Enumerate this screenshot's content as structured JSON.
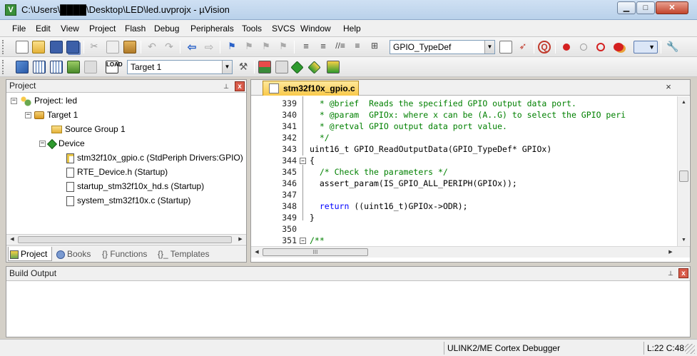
{
  "window": {
    "title": "C:\\Users\\████\\Desktop\\LED\\led.uvprojx - µVision",
    "minimize": "▁",
    "maximize": "□",
    "close": "✕"
  },
  "menu": [
    "File",
    "Edit",
    "View",
    "Project",
    "Flash",
    "Debug",
    "Peripherals",
    "Tools",
    "SVCS",
    "Window",
    "Help"
  ],
  "toolbar1": {
    "find_combo_value": "GPIO_TypeDef",
    "icons": [
      "new-file-icon",
      "open-folder-icon",
      "save-icon",
      "save-all-icon",
      "cut-icon",
      "copy-icon",
      "paste-icon",
      "undo-icon",
      "redo-icon",
      "nav-back-icon",
      "nav-forward-icon",
      "bookmark-icon",
      "bookmark-prev-icon",
      "bookmark-next-icon",
      "bookmark-clear-icon",
      "indent-icon",
      "unindent-icon",
      "comment-icon",
      "uncomment-icon",
      "find-in-files-icon",
      "find-icon",
      "debug-session-icon",
      "breakpoint-insert-icon",
      "breakpoint-enable-icon",
      "breakpoint-disable-icon",
      "breakpoint-kill-icon",
      "window-layout-icon",
      "configure-icon"
    ]
  },
  "toolbar2": {
    "target_combo_value": "Target 1",
    "icons": [
      "translate-icon",
      "build-icon",
      "rebuild-icon",
      "batch-build-icon",
      "stop-build-icon",
      "download-icon",
      "target-options-icon",
      "manage-components-icon",
      "file-extensions-icon",
      "select-packs-icon",
      "pack-installer-icon",
      "run-time-env-icon"
    ]
  },
  "project_panel": {
    "title": "Project",
    "pin": "📌",
    "close": "x",
    "tree": [
      {
        "label": "Project: led",
        "level": 0,
        "expander": "−",
        "icon": "project-icon"
      },
      {
        "label": "Target 1",
        "level": 1,
        "expander": "−",
        "icon": "target-icon"
      },
      {
        "label": "Source Group 1",
        "level": 2,
        "expander": "",
        "icon": "folder-icon"
      },
      {
        "label": "Device",
        "level": 2,
        "expander": "−",
        "icon": "device-icon"
      },
      {
        "label": "stm32f10x_gpio.c (StdPeriph Drivers:GPIO)",
        "level": 3,
        "expander": "",
        "icon": "key-file-icon"
      },
      {
        "label": "RTE_Device.h (Startup)",
        "level": 3,
        "expander": "",
        "icon": "file-icon"
      },
      {
        "label": "startup_stm32f10x_hd.s (Startup)",
        "level": 3,
        "expander": "",
        "icon": "file-icon"
      },
      {
        "label": "system_stm32f10x.c (Startup)",
        "level": 3,
        "expander": "",
        "icon": "file-icon"
      }
    ],
    "tabs": [
      {
        "label": "Project",
        "icon": "project-tab-icon",
        "active": true
      },
      {
        "label": "Books",
        "icon": "books-icon",
        "active": false
      },
      {
        "label": "{} Functions",
        "icon": "",
        "active": false
      },
      {
        "label": "{}_ Templates",
        "icon": "",
        "active": false
      }
    ]
  },
  "editor": {
    "file_tab": "stm32f10x_gpio.c",
    "close": "×",
    "lines": [
      {
        "num": "339",
        "fold": "",
        "text": "  * @brief  Reads the specified GPIO output data port.",
        "style": "comment"
      },
      {
        "num": "340",
        "fold": "",
        "text": "  * @param  GPIOx: where x can be (A..G) to select the GPIO peri",
        "style": "comment"
      },
      {
        "num": "341",
        "fold": "",
        "text": "  * @retval GPIO output data port value.",
        "style": "comment"
      },
      {
        "num": "342",
        "fold": "",
        "text": "  */",
        "style": "comment"
      },
      {
        "num": "343",
        "fold": "",
        "text": "uint16_t GPIO_ReadOutputData(GPIO_TypeDef* GPIOx)",
        "style": "code"
      },
      {
        "num": "344",
        "fold": "−",
        "text": "{",
        "style": "code"
      },
      {
        "num": "345",
        "fold": "",
        "text": "  /* Check the parameters */",
        "style": "comment"
      },
      {
        "num": "346",
        "fold": "",
        "text": "  assert_param(IS_GPIO_ALL_PERIPH(GPIOx));",
        "style": "code"
      },
      {
        "num": "347",
        "fold": "",
        "text": "",
        "style": "code"
      },
      {
        "num": "348",
        "fold": "",
        "text": "  return ((uint16_t)GPIOx->ODR);",
        "style": "return"
      },
      {
        "num": "349",
        "fold": "",
        "text": "}",
        "style": "code"
      },
      {
        "num": "350",
        "fold": "",
        "text": "",
        "style": "code"
      },
      {
        "num": "351",
        "fold": "−",
        "text": "/**",
        "style": "comment"
      }
    ],
    "hscroll_thumb": "III"
  },
  "build_output": {
    "title": "Build Output",
    "pin": "📌",
    "close": "x"
  },
  "status": {
    "debugger": "ULINK2/ME Cortex Debugger",
    "cursor": "L:22 C:48"
  }
}
